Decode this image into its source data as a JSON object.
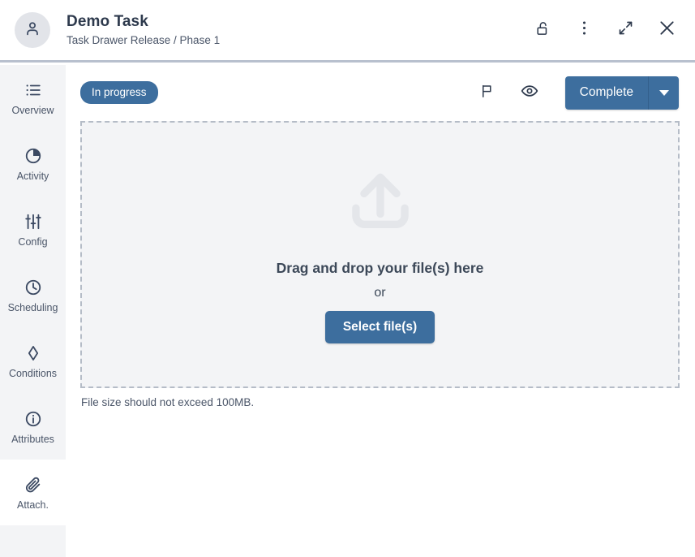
{
  "header": {
    "avatar_icon": "user-avatar-icon",
    "title": "Demo Task",
    "breadcrumb": "Task Drawer Release / Phase 1",
    "actions": [
      {
        "name": "unlock-icon",
        "label": "Unlock"
      },
      {
        "name": "more-options-icon",
        "label": "More options"
      },
      {
        "name": "expand-icon",
        "label": "Expand"
      },
      {
        "name": "close-icon",
        "label": "Close"
      }
    ]
  },
  "sidebar": {
    "items": [
      {
        "icon": "list-icon",
        "label": "Overview",
        "active": false
      },
      {
        "icon": "pie-chart-icon",
        "label": "Activity",
        "active": false
      },
      {
        "icon": "sliders-icon",
        "label": "Config",
        "active": false
      },
      {
        "icon": "clock-icon",
        "label": "Scheduling",
        "active": false
      },
      {
        "icon": "diamond-icon",
        "label": "Conditions",
        "active": false
      },
      {
        "icon": "info-icon",
        "label": "Attributes",
        "active": false
      },
      {
        "icon": "paperclip-icon",
        "label": "Attach.",
        "active": true
      }
    ]
  },
  "toolbar": {
    "status_label": "In progress",
    "flag_icon": "flag-icon",
    "watch_icon": "eye-icon",
    "complete_label": "Complete",
    "complete_caret_icon": "chevron-down-icon"
  },
  "dropzone": {
    "upload_icon": "upload-icon",
    "main_text": "Drag and drop your file(s) here",
    "or_text": "or",
    "select_label": "Select file(s)",
    "hint": "File size should not exceed 100MB."
  },
  "colors": {
    "accent": "#3d6e9e",
    "text_dark": "#2e3a4d",
    "text_muted": "#4a5568",
    "panel_bg": "#f3f4f6",
    "dashed_border": "#b5bcc7",
    "upload_icon": "#e4e6ea"
  }
}
